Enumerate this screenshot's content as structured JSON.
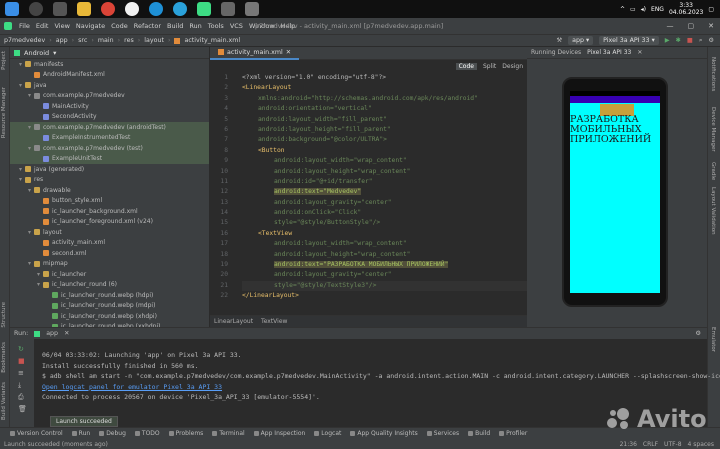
{
  "taskbar": {
    "lang": "ENG",
    "time": "3:33",
    "date": "04.06.2023"
  },
  "menu": {
    "items": [
      "File",
      "Edit",
      "View",
      "Navigate",
      "Code",
      "Refactor",
      "Build",
      "Run",
      "Tools",
      "VCS",
      "Window",
      "Help"
    ],
    "window_title": "p7medvedev - activity_main.xml [p7medvedev.app.main]"
  },
  "nav": {
    "crumbs": [
      "p7medvedev",
      "app",
      "src",
      "main",
      "res",
      "layout",
      "activity_main.xml"
    ],
    "run_config": "app",
    "device": "Pixel 3a API 33"
  },
  "project": {
    "view": "Android",
    "items": [
      {
        "label": "manifests",
        "icon": "folder",
        "indent": 1,
        "hl": false
      },
      {
        "label": "AndroidManifest.xml",
        "icon": "xml",
        "indent": 2,
        "hl": false
      },
      {
        "label": "java",
        "icon": "folder",
        "indent": 1,
        "hl": false
      },
      {
        "label": "com.example.p7medvedev",
        "icon": "pkg",
        "indent": 2,
        "hl": false
      },
      {
        "label": "MainActivity",
        "icon": "kt",
        "indent": 3,
        "hl": false
      },
      {
        "label": "SecondActivity",
        "icon": "kt",
        "indent": 3,
        "hl": false
      },
      {
        "label": "com.example.p7medvedev (androidTest)",
        "icon": "pkg",
        "indent": 2,
        "hl": true
      },
      {
        "label": "ExampleInstrumentedTest",
        "icon": "kt",
        "indent": 3,
        "hl": true
      },
      {
        "label": "com.example.p7medvedev (test)",
        "icon": "pkg",
        "indent": 2,
        "hl": true
      },
      {
        "label": "ExampleUnitTest",
        "icon": "kt",
        "indent": 3,
        "hl": true
      },
      {
        "label": "java (generated)",
        "icon": "folder",
        "indent": 1,
        "hl": false
      },
      {
        "label": "res",
        "icon": "folder",
        "indent": 1,
        "hl": false
      },
      {
        "label": "drawable",
        "icon": "folder",
        "indent": 2,
        "hl": false
      },
      {
        "label": "button_style.xml",
        "icon": "xml",
        "indent": 3,
        "hl": false
      },
      {
        "label": "ic_launcher_background.xml",
        "icon": "xml",
        "indent": 3,
        "hl": false
      },
      {
        "label": "ic_launcher_foreground.xml (v24)",
        "icon": "xml",
        "indent": 3,
        "hl": false
      },
      {
        "label": "layout",
        "icon": "folder",
        "indent": 2,
        "hl": false
      },
      {
        "label": "activity_main.xml",
        "icon": "xml",
        "indent": 3,
        "hl": false
      },
      {
        "label": "second.xml",
        "icon": "xml",
        "indent": 3,
        "hl": false
      },
      {
        "label": "mipmap",
        "icon": "folder",
        "indent": 2,
        "hl": false
      },
      {
        "label": "ic_launcher",
        "icon": "folder",
        "indent": 3,
        "hl": false
      },
      {
        "label": "ic_launcher_round (6)",
        "icon": "folder",
        "indent": 3,
        "hl": false
      },
      {
        "label": "ic_launcher_round.webp (hdpi)",
        "icon": "png",
        "indent": 4,
        "hl": false
      },
      {
        "label": "ic_launcher_round.webp (mdpi)",
        "icon": "png",
        "indent": 4,
        "hl": false
      },
      {
        "label": "ic_launcher_round.webp (xhdpi)",
        "icon": "png",
        "indent": 4,
        "hl": false
      },
      {
        "label": "ic_launcher_round.webp (xxhdpi)",
        "icon": "png",
        "indent": 4,
        "hl": false
      }
    ]
  },
  "editor": {
    "tab": "activity_main.xml",
    "modes": [
      "Code",
      "Split",
      "Design"
    ],
    "line_numbers": [
      "1",
      "2",
      "3",
      "4",
      "5",
      "6",
      "7",
      "8",
      "9",
      "10",
      "11",
      "12",
      "13",
      "14",
      "15",
      "16",
      "17",
      "18",
      "19",
      "20",
      "21",
      "22"
    ],
    "lines": [
      {
        "text": "<?xml version=\"1.0\" encoding=\"utf-8\"?>",
        "cls": "attr",
        "indent": 0
      },
      {
        "text": "<LinearLayout",
        "cls": "kw",
        "indent": 0
      },
      {
        "text": "xmlns:android=\"http://schemas.android.com/apk/res/android\"",
        "cls": "str",
        "indent": 2
      },
      {
        "text": "android:orientation=\"vertical\"",
        "cls": "str",
        "indent": 2
      },
      {
        "text": "android:layout_width=\"fill_parent\"",
        "cls": "str",
        "indent": 2
      },
      {
        "text": "android:layout_height=\"fill_parent\"",
        "cls": "str",
        "indent": 2
      },
      {
        "text": "android:background=\"@color/ULTRA\">",
        "cls": "str",
        "indent": 2
      },
      {
        "text": "<Button",
        "cls": "kw",
        "indent": 2
      },
      {
        "text": "android:layout_width=\"wrap_content\"",
        "cls": "str",
        "indent": 4
      },
      {
        "text": "android:layout_height=\"wrap_content\"",
        "cls": "str",
        "indent": 4
      },
      {
        "text": "android:id=\"@+id/transfer\"",
        "cls": "str",
        "indent": 4
      },
      {
        "text": "android:text=\"Medvedev\"",
        "cls": "hl-str",
        "indent": 4
      },
      {
        "text": "android:layout_gravity=\"center\"",
        "cls": "str",
        "indent": 4
      },
      {
        "text": "android:onClick=\"Click\"",
        "cls": "str",
        "indent": 4
      },
      {
        "text": "style=\"@style/ButtonStyle\"/>",
        "cls": "str",
        "indent": 4
      },
      {
        "text": "<TextView",
        "cls": "kw",
        "indent": 2
      },
      {
        "text": "android:layout_width=\"wrap_content\"",
        "cls": "str",
        "indent": 4
      },
      {
        "text": "android:layout_height=\"wrap_content\"",
        "cls": "str",
        "indent": 4
      },
      {
        "text": "android:text=\"РАЗРАБОТКА МОБИЛЬНЫХ ПРИЛОЖЕНИЙ\"",
        "cls": "hl-str",
        "indent": 4
      },
      {
        "text": "android:layout_gravity=\"center\"",
        "cls": "str",
        "indent": 4
      },
      {
        "text": "style=\"@style/TextStyle3\"/>",
        "cls": "str",
        "indent": 4
      },
      {
        "text": "</LinearLayout>",
        "cls": "kw",
        "indent": 0
      }
    ],
    "crumbs": [
      "LinearLayout",
      "TextView"
    ]
  },
  "running_devices": {
    "tabs": [
      "Running Devices",
      "Pixel 3a API 33"
    ],
    "app_text": "РАЗРАБОТКА МОБИЛЬНЫХ ПРИЛОЖЕНИЙ"
  },
  "run": {
    "label": "Run:",
    "config": "app",
    "console": [
      {
        "text": "06/04 03:33:02: Launching 'app' on Pixel 3a API 33.",
        "link": false
      },
      {
        "text": "Install successfully finished in 560 ms.",
        "link": false
      },
      {
        "text": "$ adb shell am start -n \"com.example.p7medvedev/com.example.p7medvedev.MainActivity\" -a android.intent.action.MAIN -c android.intent.category.LAUNCHER --splashscreen-show-icon",
        "link": false
      },
      {
        "text": "Open logcat panel for emulator Pixel 3a API 33",
        "link": true
      },
      {
        "text": "Connected to process 20567 on device 'Pixel_3a_API_33 [emulator-5554]'.",
        "link": false
      }
    ],
    "toast": "Launch succeeded"
  },
  "bottom_tools": [
    "Version Control",
    "Run",
    "Debug",
    "TODO",
    "Problems",
    "Terminal",
    "App Inspection",
    "Logcat",
    "App Quality Insights",
    "Services",
    "Build",
    "Profiler"
  ],
  "status": {
    "message": "Launch succeeded (moments ago)",
    "position": "21:36",
    "encoding": "CRLF",
    "charset": "UTF-8",
    "indent": "4 spaces"
  },
  "watermark": "Avito",
  "colors": {
    "screen_bg": "#00ffff",
    "app_bar": "#3700b3",
    "app_button": "#c8a03a"
  }
}
